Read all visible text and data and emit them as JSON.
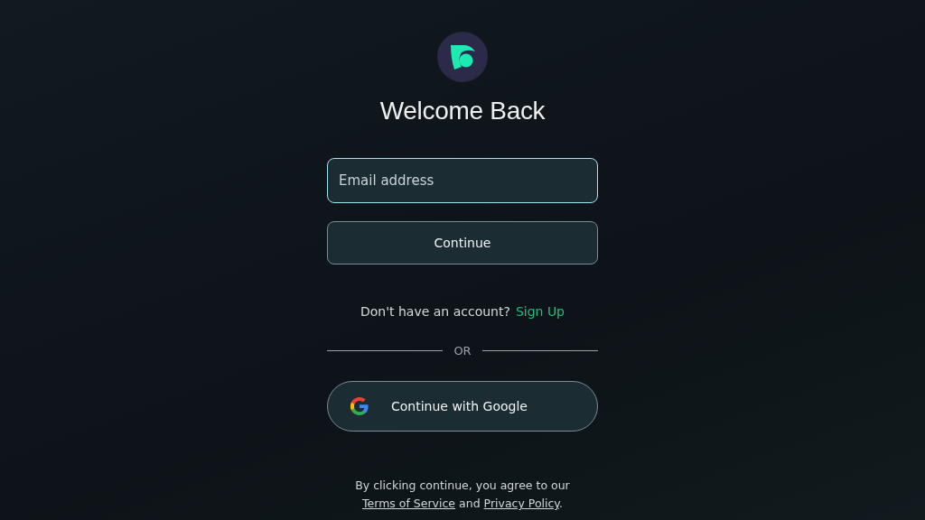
{
  "title": "Welcome Back",
  "email_field": {
    "placeholder": "Email address",
    "focused": true
  },
  "continue_button": "Continue",
  "signup_prompt": {
    "text": "Don't have an account?",
    "link": "Sign Up"
  },
  "divider_label": "OR",
  "google_button": "Continue with Google",
  "footer": {
    "before": "By clicking continue, you agree to our",
    "terms": "Terms of Service",
    "middle": "and",
    "privacy": "Privacy Policy",
    "after": "."
  }
}
